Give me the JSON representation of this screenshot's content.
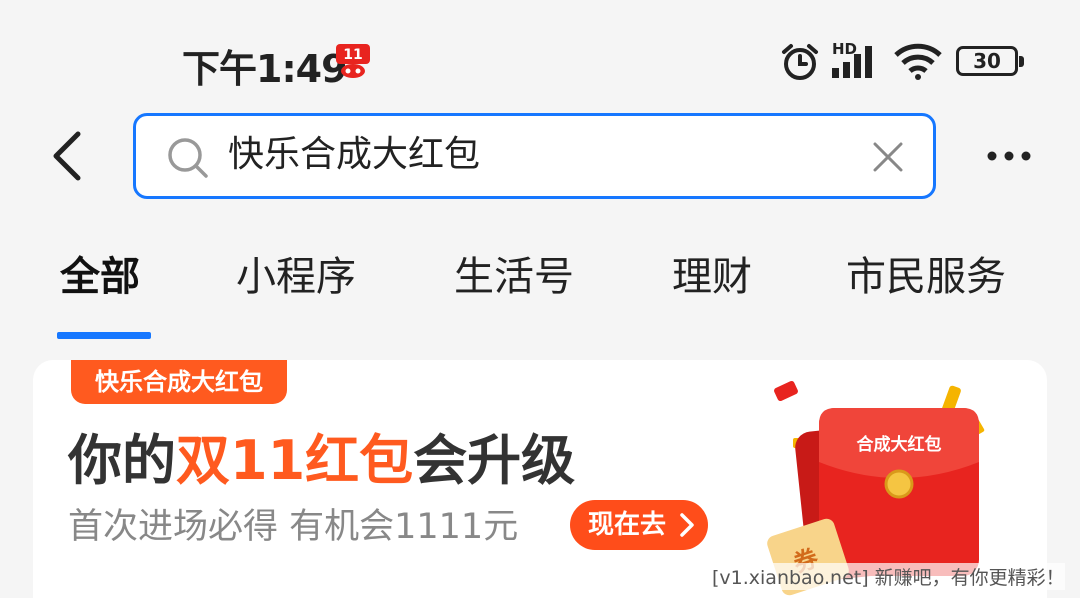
{
  "status_bar": {
    "time": "下午1:49",
    "network_badge": "HD",
    "battery": "30",
    "icons": [
      "app-notification-icon",
      "alarm-icon",
      "signal-icon",
      "wifi-icon",
      "battery-icon"
    ]
  },
  "header": {
    "search": {
      "value": "快乐合成大红包",
      "icon": "search-icon",
      "clear_icon": "close-icon"
    },
    "back_icon": "chevron-left-icon",
    "more_icon": "more-horizontal-icon"
  },
  "tabs": [
    {
      "label": "全部",
      "active": true
    },
    {
      "label": "小程序",
      "active": false
    },
    {
      "label": "生活号",
      "active": false
    },
    {
      "label": "理财",
      "active": false
    },
    {
      "label": "市民服务",
      "active": false
    }
  ],
  "promo": {
    "tag": "快乐合成大红包",
    "headline_prefix": "你的",
    "headline_highlight": "双11红包",
    "headline_suffix": "会升级",
    "subtitle": "首次进场必得 有机会1111元",
    "cta": "现在去",
    "envelope_label": "合成大红包",
    "coupon_char": "券",
    "accent_color": "#ff5a1f"
  },
  "watermark": "[v1.xianbao.net] 新赚吧，有你更精彩！",
  "colors": {
    "primary": "#1677ff",
    "promo_orange": "#ff5a1f",
    "envelope_red": "#e8241f"
  }
}
